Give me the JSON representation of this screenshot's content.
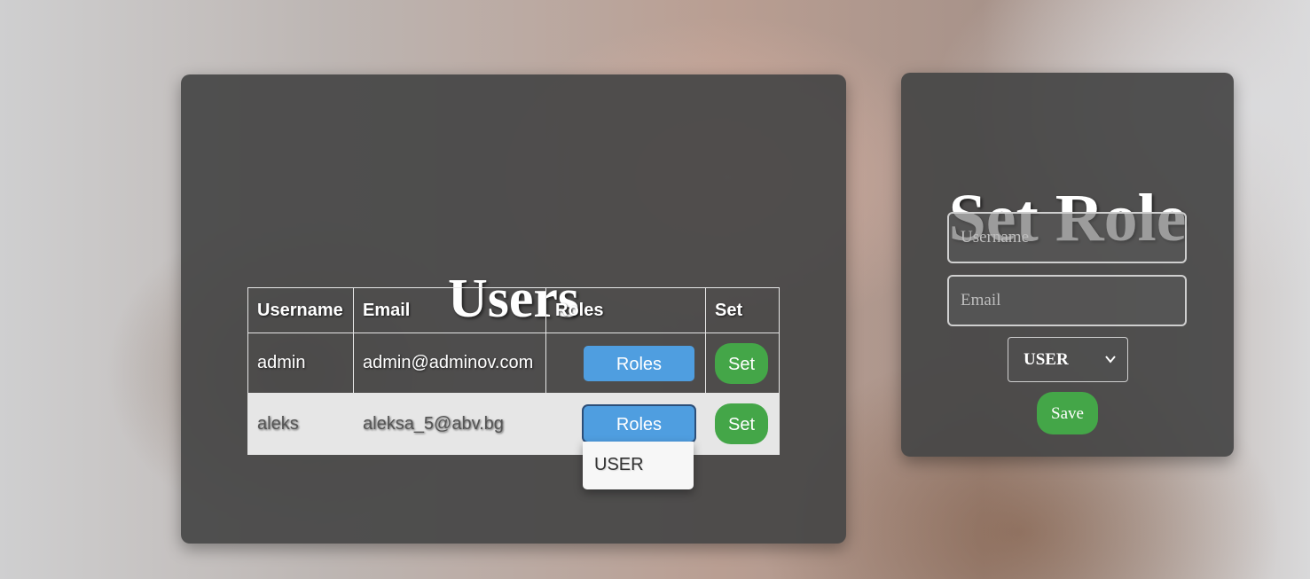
{
  "users_panel": {
    "title": "Users",
    "table": {
      "headers": [
        "Username",
        "Email",
        "Roles",
        "Set"
      ],
      "rows": [
        {
          "username": "admin",
          "email": "admin@adminov.com",
          "roles_label": "Roles",
          "set_label": "Set"
        },
        {
          "username": "aleks",
          "email": "aleksa_5@abv.bg",
          "roles_label": "Roles",
          "set_label": "Set"
        }
      ]
    },
    "dropdown": {
      "items": [
        "USER"
      ]
    }
  },
  "role_panel": {
    "title": "Set Role",
    "username_placeholder": "Username",
    "email_placeholder": "Email",
    "role_select_value": "USER",
    "save_label": "Save"
  },
  "colors": {
    "roles_button": "#4f9ee0",
    "set_button": "#44a648",
    "panel_background": "#464646"
  }
}
